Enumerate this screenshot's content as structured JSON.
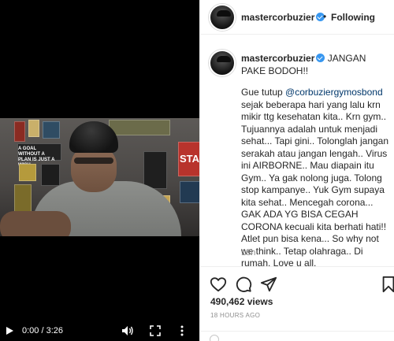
{
  "video": {
    "wall_sign_text_a": "A GOAL WITHOUT A PLAN IS JUST A WISH",
    "wall_sign_text_b": "STA",
    "current_time": "0:00",
    "separator": "/",
    "duration": "3:26",
    "time_display": "0:00 / 3:26",
    "icons": [
      "play-icon",
      "volume-icon",
      "fullscreen-icon",
      "more-options-icon"
    ]
  },
  "header": {
    "username": "mastercorbuzier",
    "separator": "•",
    "follow_state": "Following"
  },
  "caption": {
    "username": "mastercorbuzier",
    "title": "JANGAN PAKE BODOH!!",
    "body_prefix": "Gue tutup ",
    "mention": "@corbuziergymosbond",
    "body_rest": " sejak beberapa hari yang lalu krn mikir ttg kesehatan kita.. Krn gym.. Tujuannya adalah untuk menjadi sehat... Tapi gini.. Tolonglah jangan serakah atau jangan lengah.. Virus ini AIRBORNE.. Mau diapain itu Gym.. Ya gak nolong juga. Tolong stop kampanye.. Yuk Gym supaya kita sehat.. Mencegah corona... GAK ADA YG BISA CEGAH CORONA kecuali kita berhati hati!! Atlet pun bisa kena... So why not we think.. Tetap olahraga.. Di rumah. Love u all.",
    "time_ago": "18h"
  },
  "actions": {
    "icons": [
      "heart-icon",
      "comment-icon",
      "share-icon",
      "bookmark-icon"
    ],
    "views": "490,462 views",
    "posted": "18 HOURS AGO"
  },
  "colors": {
    "verified": "#3897f0",
    "mention": "#00376b",
    "muted": "#8e8e8e",
    "text": "#262626"
  }
}
